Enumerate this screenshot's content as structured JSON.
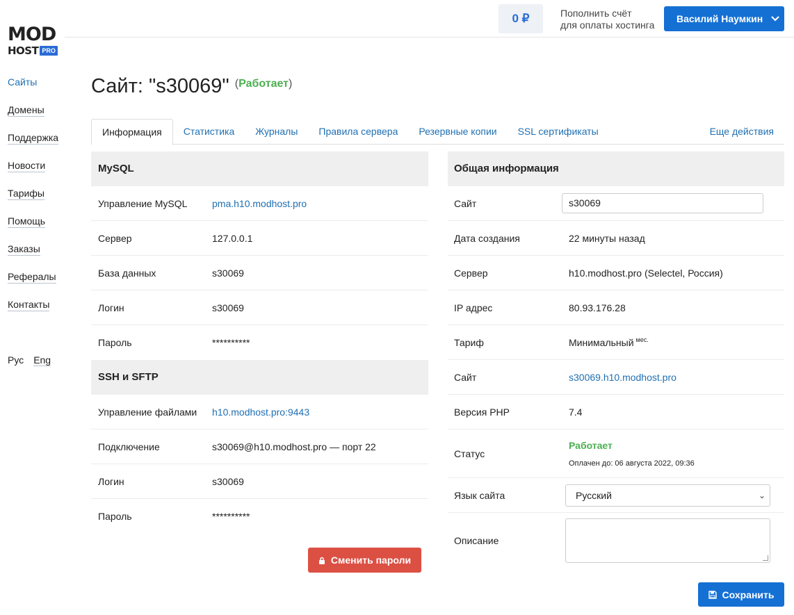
{
  "logo": {
    "line1": "MOD",
    "line2": "HOST",
    "badge": "PRO"
  },
  "sidebar": {
    "items": [
      {
        "label": "Сайты",
        "active": true
      },
      {
        "label": "Домены"
      },
      {
        "label": "Поддержка"
      },
      {
        "label": "Новости"
      },
      {
        "label": "Тарифы"
      },
      {
        "label": "Помощь"
      },
      {
        "label": "Заказы"
      },
      {
        "label": "Рефералы"
      },
      {
        "label": "Контакты"
      }
    ],
    "lang_ru": "Рус",
    "lang_en": "Eng"
  },
  "header": {
    "balance": "0 ₽",
    "topup_line1": "Пополнить счёт",
    "topup_line2": "для оплаты хостинга",
    "user_name": "Василий Наумкин"
  },
  "page": {
    "title": "Сайт: \"s30069\"",
    "status_open": "(",
    "status": "Работает",
    "status_close": ")"
  },
  "tabs": [
    {
      "label": "Информация",
      "active": true
    },
    {
      "label": "Статистика"
    },
    {
      "label": "Журналы"
    },
    {
      "label": "Правила сервера"
    },
    {
      "label": "Резервные копии"
    },
    {
      "label": "SSL сертификаты"
    },
    {
      "label": "Еще действия"
    }
  ],
  "mysql": {
    "heading": "MySQL",
    "rows": [
      {
        "key": "Управление MySQL",
        "value": "pma.h10.modhost.pro"
      },
      {
        "key": "Сервер",
        "value": "127.0.0.1"
      },
      {
        "key": "База данных",
        "value": "s30069"
      },
      {
        "key": "Логин",
        "value": "s30069"
      },
      {
        "key": "Пароль",
        "value": "**********"
      }
    ]
  },
  "ssh": {
    "heading": "SSH и SFTP",
    "rows": [
      {
        "key": "Управление файлами",
        "value": "h10.modhost.pro:9443"
      },
      {
        "key": "Подключение",
        "value": "s30069@h10.modhost.pro — порт 22"
      },
      {
        "key": "Логин",
        "value": "s30069"
      },
      {
        "key": "Пароль",
        "value": "**********"
      }
    ]
  },
  "change_passwords_label": "Сменить пароли",
  "general": {
    "heading": "Общая информация",
    "site_key": "Сайт",
    "site_value": "s30069",
    "created_key": "Дата создания",
    "created_value": "22 минуты назад",
    "server_key": "Сервер",
    "server_value": "h10.modhost.pro (Selectel, Россия)",
    "ip_key": "IP адрес",
    "ip_value": "80.93.176.28",
    "tariff_key": "Тариф",
    "tariff_value": "Минимальный",
    "tariff_sup": "мес.",
    "domain_key": "Сайт",
    "domain_value": "s30069.h10.modhost.pro",
    "php_key": "Версия PHP",
    "php_value": "7.4",
    "status_key": "Статус",
    "status_value": "Работает",
    "paid_until": "Оплачен до: 06 августа 2022, 09:36",
    "lang_key": "Язык сайта",
    "lang_value": "Русский",
    "desc_key": "Описание",
    "desc_value": ""
  },
  "save_label": "Сохранить",
  "colors": {
    "primary": "#1570d4",
    "link": "#1f6fb2",
    "danger": "#dc5044",
    "success": "#4caf50"
  }
}
